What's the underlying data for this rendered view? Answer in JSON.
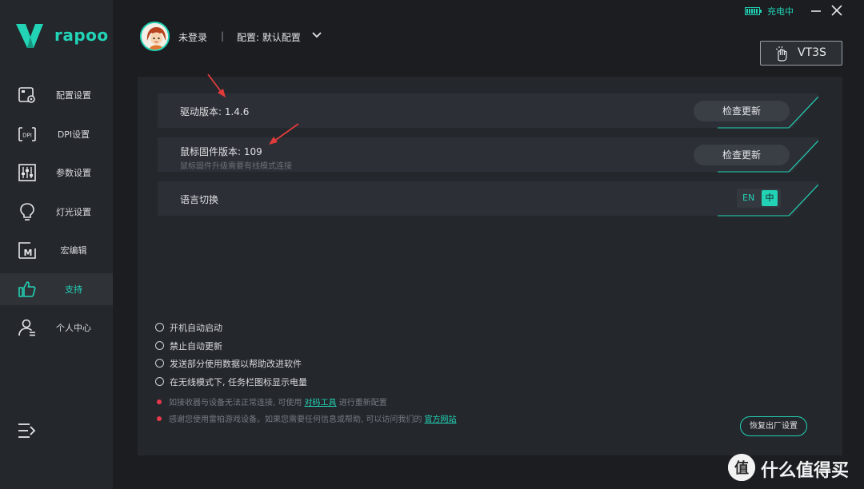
{
  "brand": {
    "logo_text": "rapoo"
  },
  "header": {
    "login_status": "未登录",
    "separator": "|",
    "config_label": "配置: 默认配置",
    "charging_status": "充电中",
    "device_name": "VT3S"
  },
  "sidebar": {
    "items": [
      {
        "label": "配置设置",
        "icon": "config-icon"
      },
      {
        "label": "DPI设置",
        "icon": "dpi-icon"
      },
      {
        "label": "参数设置",
        "icon": "sliders-icon"
      },
      {
        "label": "灯光设置",
        "icon": "bulb-icon"
      },
      {
        "label": "宏编辑",
        "icon": "macro-icon"
      },
      {
        "label": "支持",
        "icon": "thumbs-up-icon",
        "active": true
      },
      {
        "label": "个人中心",
        "icon": "user-icon"
      }
    ]
  },
  "support": {
    "driver": {
      "label": "驱动版本: 1.4.6",
      "button": "检查更新"
    },
    "firmware": {
      "label": "鼠标固件版本: 109",
      "sub": "鼠标固件升级需要有线模式连接",
      "button": "检查更新"
    },
    "language": {
      "label": "语言切换",
      "en": "EN",
      "zh": "中",
      "selected": "中"
    },
    "options": [
      {
        "label": "开机自动启动",
        "checked": false
      },
      {
        "label": "禁止自动更新",
        "checked": false
      },
      {
        "label": "发送部分使用数据以帮助改进软件",
        "checked": false
      },
      {
        "label": "在无线模式下, 任务栏图标显示电量",
        "checked": false
      }
    ],
    "notes": [
      {
        "prefix": "如接收器与设备无法正常连接, 可使用",
        "link": "对码工具",
        "suffix": "进行重新配置"
      },
      {
        "prefix": "感谢您使用雷柏游戏设备。如果您需要任何信息或帮助, 可以访问我们的",
        "link": "官方网站",
        "suffix": ""
      }
    ],
    "factory_reset": "恢复出厂设置"
  },
  "watermark": {
    "text": "什么值得买",
    "logo_char": "值"
  },
  "colors": {
    "accent": "#22d3b6",
    "annotation_arrow": "#e23b3b",
    "note_dot": "#e8394c"
  }
}
